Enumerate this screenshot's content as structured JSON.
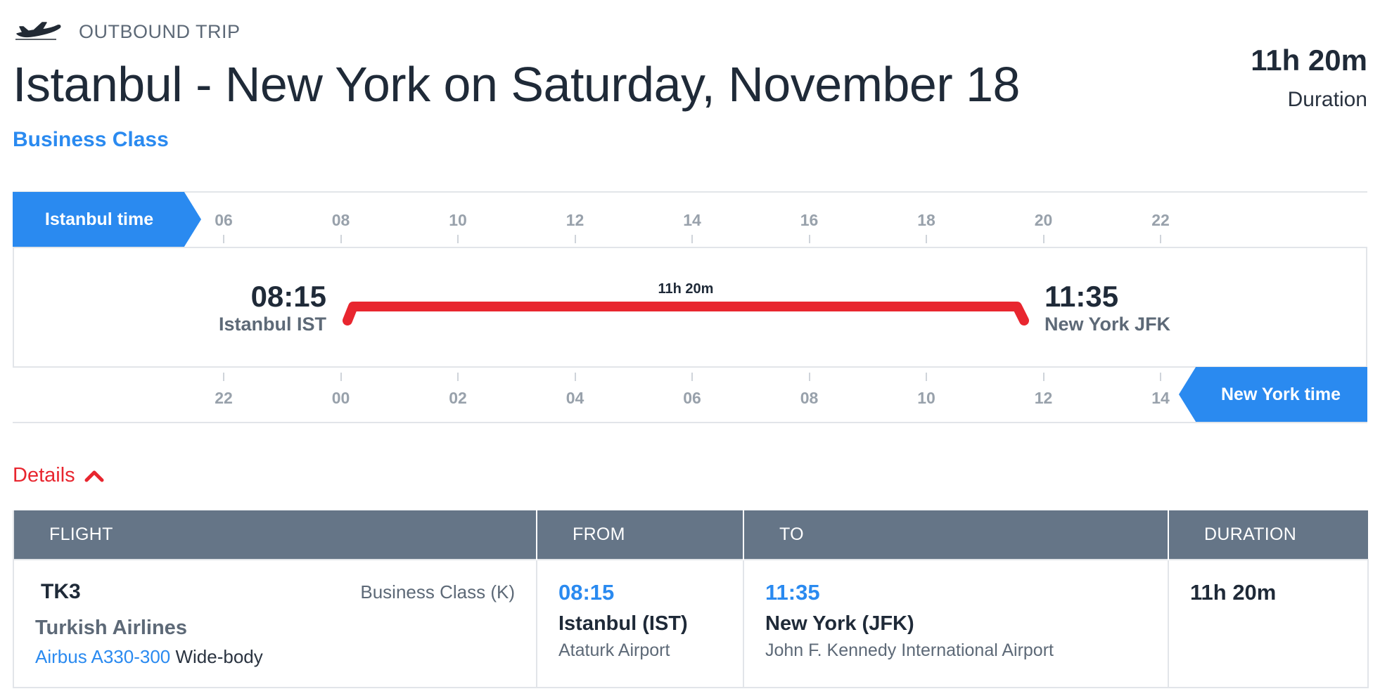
{
  "header": {
    "trip_label": "OUTBOUND TRIP",
    "route_title": "Istanbul - New York on Saturday, November 18",
    "cabin": "Business Class",
    "duration": "11h 20m",
    "duration_label": "Duration"
  },
  "timeline": {
    "origin_tz_label": "Istanbul time",
    "dest_tz_label": "New York time",
    "origin_ticks": [
      "06",
      "08",
      "10",
      "12",
      "14",
      "16",
      "18",
      "20",
      "22"
    ],
    "dest_ticks": [
      "22",
      "00",
      "02",
      "04",
      "06",
      "08",
      "10",
      "12",
      "14"
    ],
    "departure_time": "08:15",
    "departure_place": "Istanbul IST",
    "arrival_time": "11:35",
    "arrival_place": "New York JFK",
    "bar_duration": "11h 20m"
  },
  "details": {
    "toggle_label": "Details",
    "columns": [
      "FLIGHT",
      "FROM",
      "TO",
      "DURATION"
    ],
    "flight": {
      "number": "TK3",
      "class": "Business Class (K)",
      "airline": "Turkish Airlines",
      "aircraft_model": "Airbus A330-300",
      "aircraft_type": "Wide-body"
    },
    "from": {
      "time": "08:15",
      "city": "Istanbul (IST)",
      "airport": "Ataturk Airport"
    },
    "to": {
      "time": "11:35",
      "city": "New York (JFK)",
      "airport": "John F. Kennedy International Airport"
    },
    "duration": "11h 20m"
  },
  "colors": {
    "accent_blue": "#2a8af0",
    "flight_bar_red": "#e8262f",
    "table_header": "#657587"
  },
  "icons": [
    "airplane-icon",
    "chevron-up-icon"
  ]
}
